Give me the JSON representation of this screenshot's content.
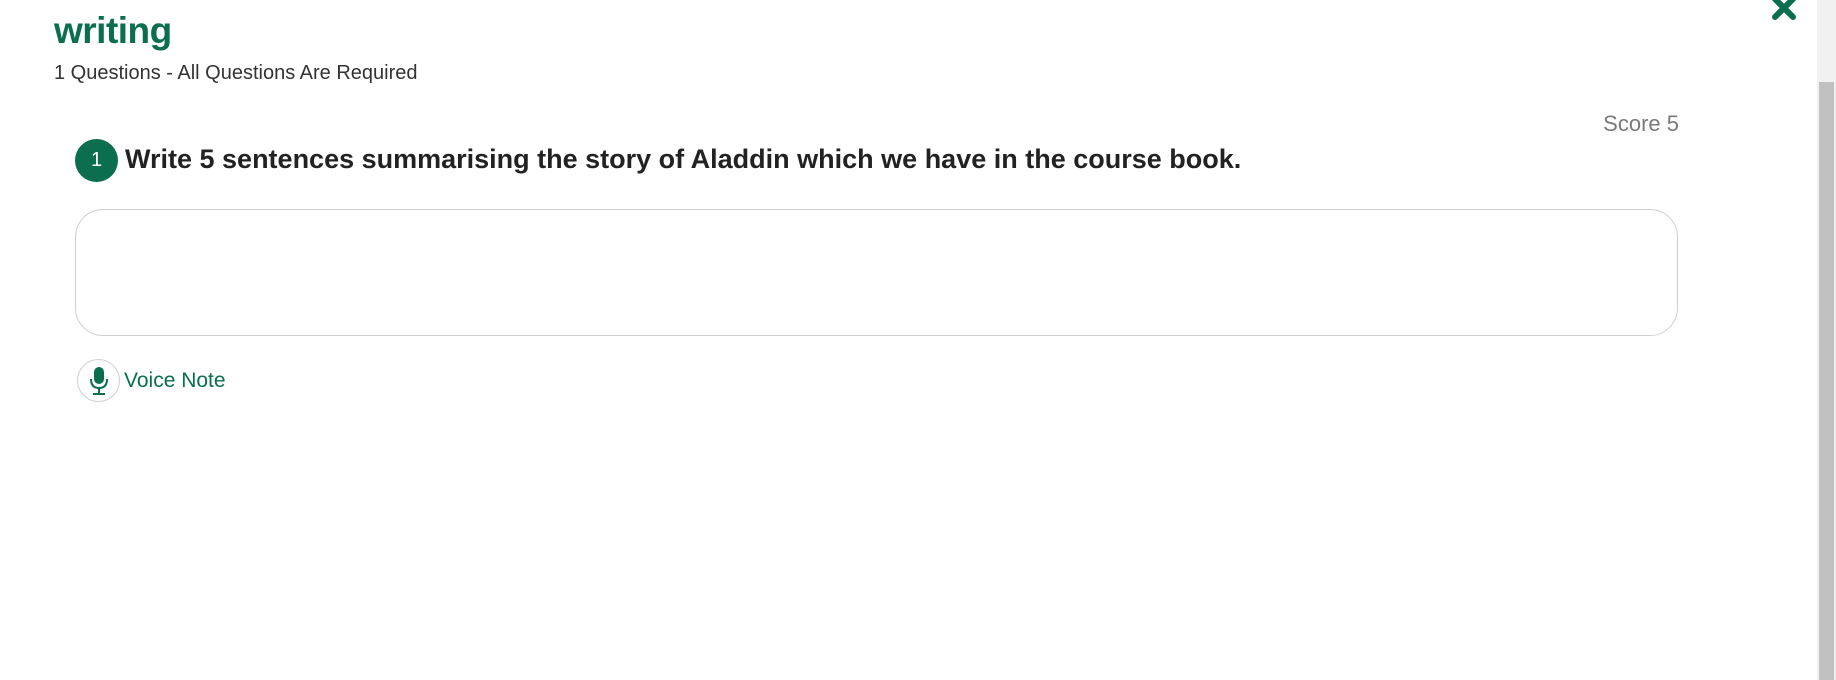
{
  "header": {
    "title": "writing",
    "subtitle": "1 Questions - All Questions Are Required"
  },
  "question": {
    "number": "1",
    "score_label": "Score 5",
    "text": "Write 5 sentences summarising the story of Aladdin which we have in the course book.",
    "answer_value": "",
    "answer_placeholder": ""
  },
  "voice_note": {
    "label": "Voice Note",
    "icon": "microphone-icon"
  },
  "close": {
    "icon": "close-icon"
  },
  "colors": {
    "accent": "#0b6e4f",
    "text": "#222222",
    "muted": "#7a7a7a",
    "border": "#cfcfcf"
  }
}
